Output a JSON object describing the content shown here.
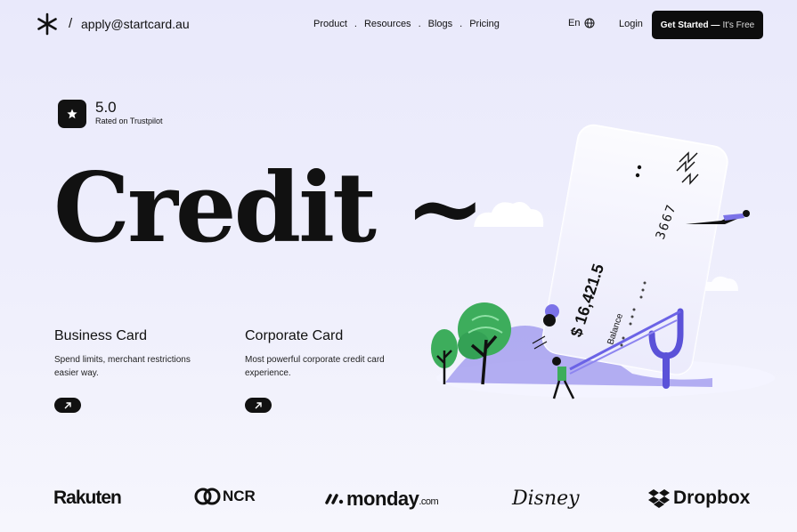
{
  "header": {
    "email": "apply@startcard.au",
    "nav": [
      "Product",
      "Resources",
      "Blogs",
      "Pricing"
    ],
    "language": "En",
    "login": "Login",
    "cta_bold": "Get Started —",
    "cta_light": "It's Free"
  },
  "rating": {
    "score": "5.0",
    "label": "Rated on Trustpilot"
  },
  "hero": {
    "headline": "Credit ~",
    "card_numbers": "3667",
    "balance_value": "$ 16,421.5",
    "balance_label": "Balance"
  },
  "cards": [
    {
      "title": "Business Card",
      "desc": "Spend limits, merchant restrictions easier way."
    },
    {
      "title": "Corporate Card",
      "desc": "Most powerful corporate credit card experience."
    }
  ],
  "brands": [
    "Rakuten",
    "NCR",
    "monday",
    ".com",
    "Disney",
    "Dropbox"
  ],
  "colors": {
    "accent": "#6b63e6",
    "dark": "#0d0d0d",
    "tree_green": "#3dad5c"
  },
  "icons": {
    "logo": "asterisk-logo-icon",
    "language": "globe-icon",
    "trustpilot": "star-icon",
    "card_link": "arrow-up-right-icon"
  }
}
